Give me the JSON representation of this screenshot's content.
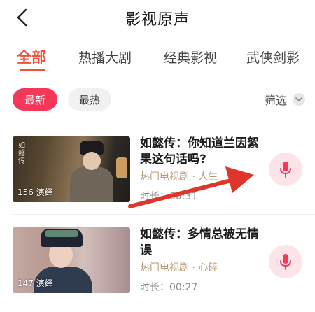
{
  "header": {
    "title": "影视原声",
    "back_icon": "back-chevron-icon"
  },
  "tabs": [
    {
      "label": "全部",
      "active": true
    },
    {
      "label": "热播大剧",
      "active": false
    },
    {
      "label": "经典影视",
      "active": false
    },
    {
      "label": "武侠剑影",
      "active": false
    }
  ],
  "filters": {
    "latest_label": "最新",
    "hot_label": "最热",
    "filter_label": "筛选",
    "selected": "最新"
  },
  "items": [
    {
      "title": "如懿传：你知道兰因絮果这句话吗?",
      "thumb_text": "如懿传",
      "play_count": "156 演绎",
      "meta": "热门电视剧 · 人生",
      "duration": "时长：00:31"
    },
    {
      "title": "如懿传：多情总被无情误",
      "play_count": "147 演绎",
      "meta": "热门电视剧 · 心碎",
      "duration": "时长：00:27"
    }
  ],
  "colors": {
    "accent": "#f0503c",
    "chip_active": "#f4385a",
    "mic_bg": "#fde4e8",
    "mic_icon": "#f4385a",
    "meta_text": "#b89a78",
    "annotation_arrow": "#e0352b"
  },
  "icons": {
    "mic": "microphone-icon",
    "filter_chevron": "chevron-down-icon"
  }
}
